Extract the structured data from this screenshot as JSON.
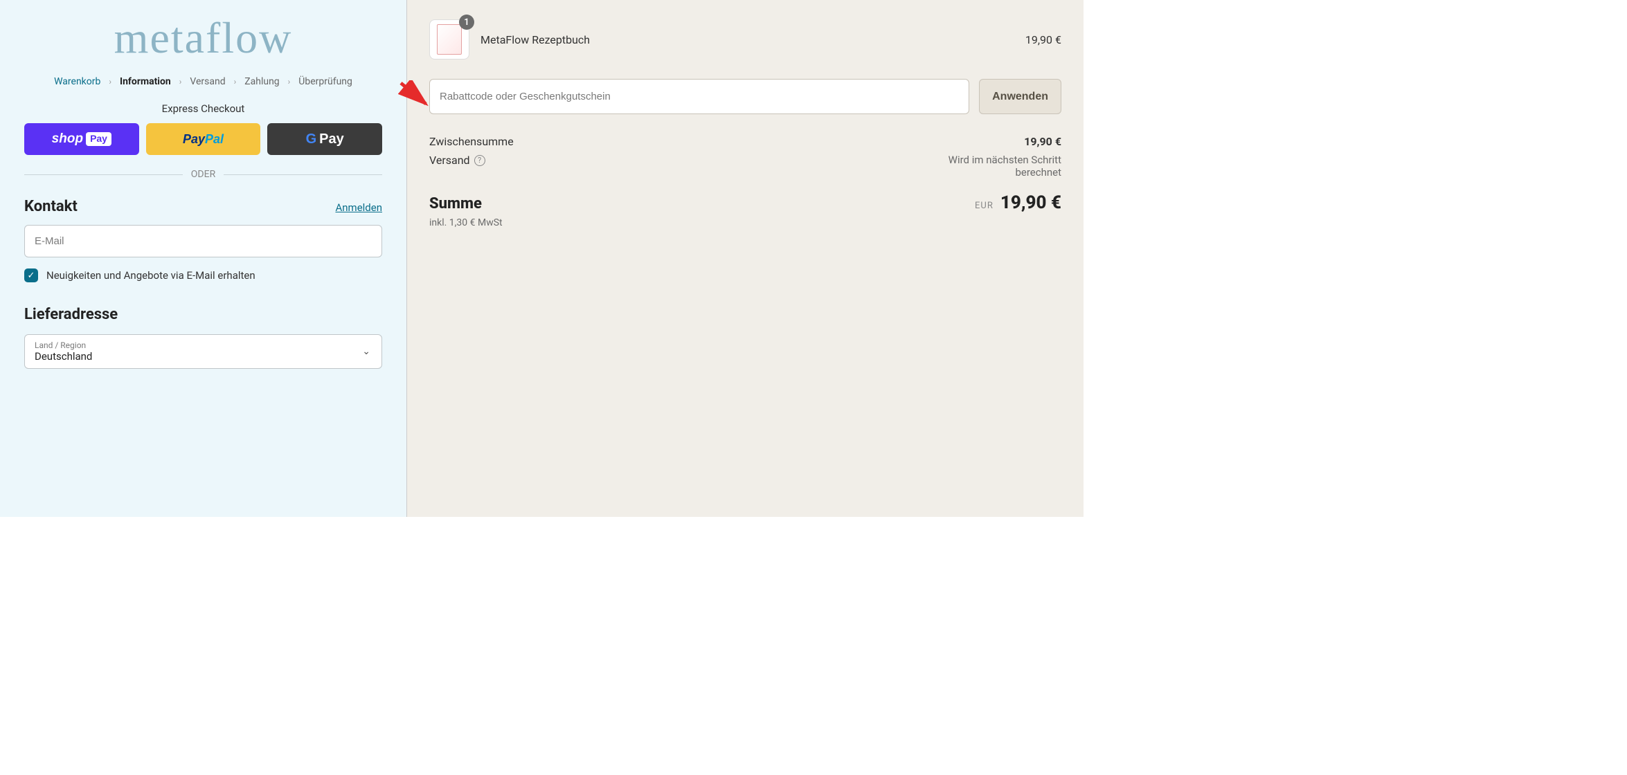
{
  "logo_text": "metaflow",
  "breadcrumb": {
    "cart": "Warenkorb",
    "info": "Information",
    "shipping": "Versand",
    "payment": "Zahlung",
    "review": "Überprüfung"
  },
  "express": {
    "title": "Express Checkout",
    "shoppay_shop": "shop",
    "shoppay_pay": "Pay",
    "paypal_pay": "Pay",
    "paypal_pal": "Pal",
    "gpay_pay": "Pay"
  },
  "divider_label": "ODER",
  "contact": {
    "heading": "Kontakt",
    "login_link": "Anmelden",
    "email_placeholder": "E-Mail",
    "newsletter_label": "Neuigkeiten und Angebote via E-Mail erhalten"
  },
  "address": {
    "heading": "Lieferadresse",
    "country_label": "Land / Region",
    "country_value": "Deutschland"
  },
  "cart": {
    "item_name": "MetaFlow Rezeptbuch",
    "item_price": "19,90 €",
    "quantity_badge": "1"
  },
  "discount": {
    "placeholder": "Rabattcode oder Geschenkgutschein",
    "apply_label": "Anwenden"
  },
  "summary": {
    "subtotal_label": "Zwischensumme",
    "subtotal_value": "19,90 €",
    "shipping_label": "Versand",
    "shipping_note": "Wird im nächsten Schritt berechnet",
    "total_label": "Summe",
    "currency": "EUR",
    "total_value": "19,90 €",
    "tax_note": "inkl. 1,30 € MwSt"
  }
}
